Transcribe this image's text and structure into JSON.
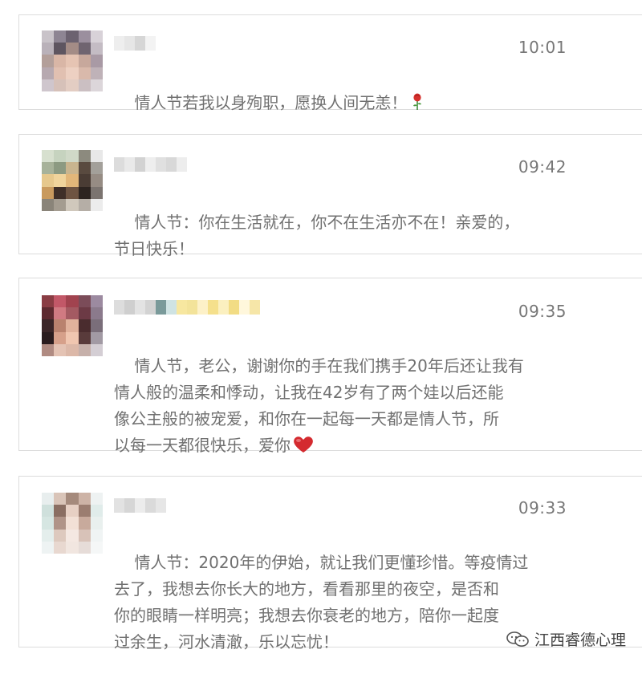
{
  "posts": [
    {
      "time": "10:01",
      "text": "情人节若我以身殉职，愿换人间无恙！",
      "emoji": "rose-icon"
    },
    {
      "time": "09:42",
      "text": "情人节：你在生活就在，你不在生活亦不在！亲爱的，\n节日快乐！",
      "emoji": ""
    },
    {
      "time": "09:35",
      "text": "情人节，老公，谢谢你的手在我们携手20年后还让我有\n情人般的温柔和悸动，让我在42岁有了两个娃以后还能\n像公主般的被宠爱，和你在一起每一天都是情人节，所\n以每一天都很快乐，爱你",
      "emoji": "heart-icon"
    },
    {
      "time": "09:33",
      "text": "情人节：2020年的伊始，就让我们更懂珍惜。等疫情过\n去了，我想去你长大的地方，看看那里的夜空，是否和\n你的眼睛一样明亮；我想去你衰老的地方，陪你一起度\n过余生，河水清澈，乐以忘忧！",
      "emoji": ""
    }
  ],
  "watermark": {
    "icon": "wechat-official-account-icon",
    "label": "江西睿德心理"
  },
  "colors": {
    "text": "#707070",
    "time": "#777777",
    "border": "#dcdcdc"
  }
}
